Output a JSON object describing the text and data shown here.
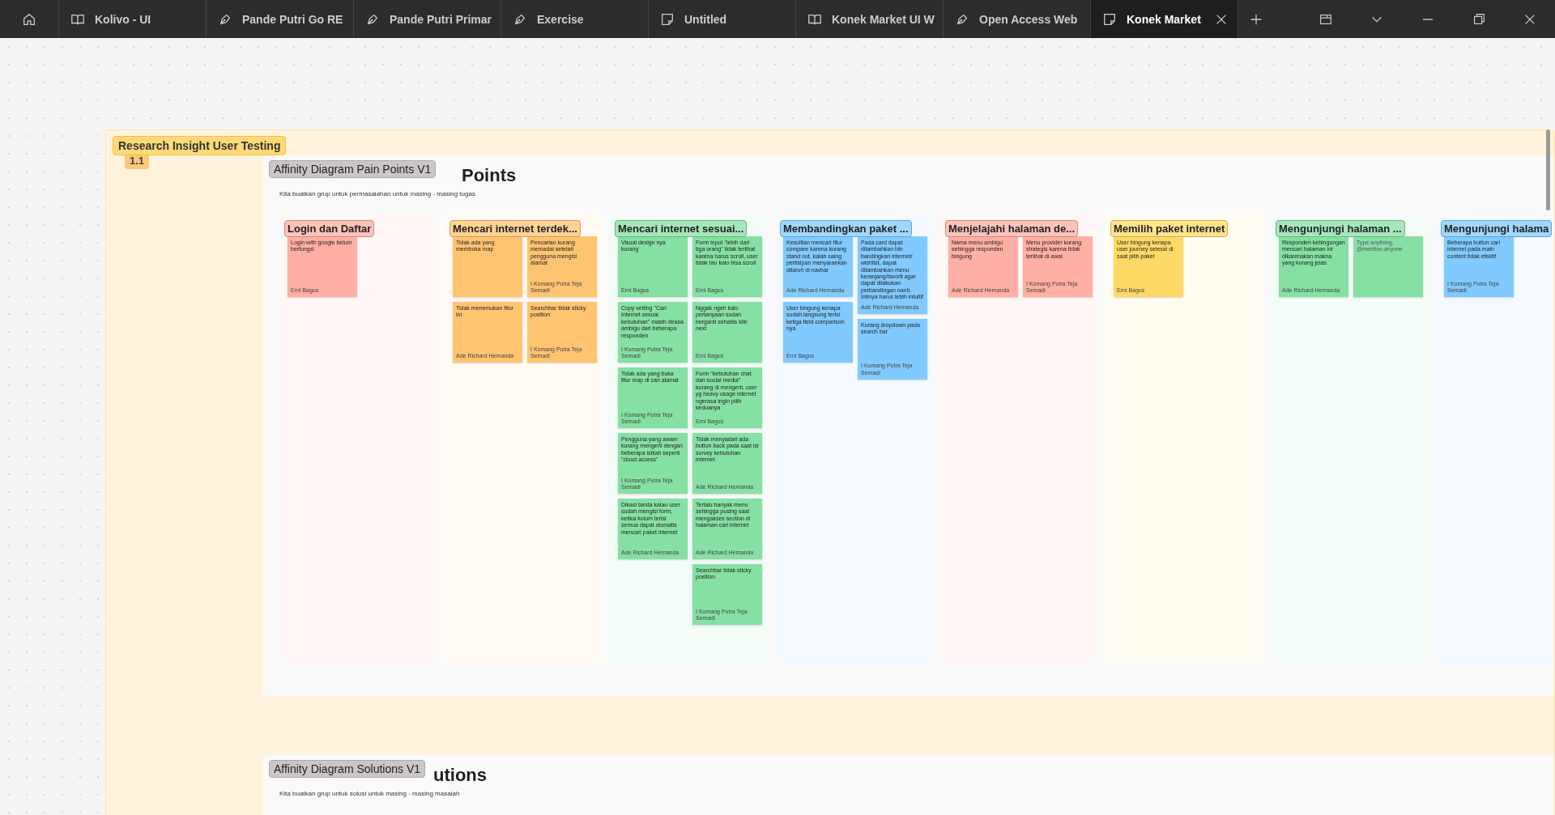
{
  "tabs": [
    {
      "kind": "book",
      "label": "Kolivo - UI",
      "selected": false
    },
    {
      "kind": "pen",
      "label": "Pande Putri Go RE",
      "selected": false
    },
    {
      "kind": "pen",
      "label": "Pande Putri Primar",
      "selected": false
    },
    {
      "kind": "pen",
      "label": "Exercise",
      "selected": false
    },
    {
      "kind": "note",
      "label": "Untitled",
      "selected": false
    },
    {
      "kind": "book",
      "label": "Konek Market UI W",
      "selected": false
    },
    {
      "kind": "pen",
      "label": "Open Access Web",
      "selected": false
    },
    {
      "kind": "note",
      "label": "Konek Market",
      "selected": true
    }
  ],
  "section": {
    "label": "Research Insight User Testing",
    "badge": "1.1"
  },
  "frames": [
    {
      "label": "Affinity Diagram Pain Points V1",
      "heading": "Points",
      "subtitle": "Kita buatkan grup untuk permasalahan untuk masing - masing tugas",
      "columns": [
        {
          "title": "Login dan Daftar",
          "color": "#ffafa3",
          "stacks": [
            [
              {
                "text": "Login with google belum berfungsi",
                "author": "Erni Bagus"
              }
            ]
          ]
        },
        {
          "title": "Mencari internet terdek...",
          "color": "#ffc470",
          "stacks": [
            [
              {
                "text": "Tidak ada yang membuka map"
              },
              {
                "text": "Tidak menemukan fitur ini",
                "author": "Ade Richard Hernanda"
              }
            ],
            [
              {
                "text": "Pencarian kurang memadai setelah pengguna mengisi alamat",
                "author": "I Komang Putra Teja Semadi"
              },
              {
                "text": "Searchbar tidak sticky position",
                "author": "I Komang Putra Teja Semadi"
              }
            ]
          ]
        },
        {
          "title": "Mencari internet sesuai...",
          "color": "#85e0a3",
          "stacks": [
            [
              {
                "text": "Visual design nya kurang",
                "author": "Erni Bagus"
              },
              {
                "text": "Copy writing \"Cari Internet sesuai kebutuhan\" masih dirasa ambigu dari beberapa responden",
                "author": "I Komang Putra Teja Semadi"
              },
              {
                "text": "Tidak ada yang buka fitur map di cari alamat",
                "author": "I Komang Putra Teja Semadi"
              },
              {
                "text": "Pengguna yang awam kurang mengerti dengan beberapa istilah seperti \"cloud access\"",
                "author": "I Komang Putra Teja Semadi"
              },
              {
                "text": "Dikasi tanda kalau user sudah mengisi form, ketika kolom terisi semua dapat otomatis mencari paket internet",
                "author": "Ade Richard Hernanda"
              }
            ],
            [
              {
                "text": "Form input \"lebih dari tiga orang\" tidak terlihat karena harus scroll, user tidak tau kalo bisa scroll",
                "author": "Erni Bagus"
              },
              {
                "text": "Nggak ngeh kalo pertanyaan sudah berganti sehabis klik next",
                "author": "Erni Bagus"
              },
              {
                "text": "Form \"kebutuhan chat dan social media\" kurang di mengerti, user yg heavy usage internet ngerasa ingin pilih keduanya",
                "author": "Erni Bagus"
              },
              {
                "text": "Tidak menyadari ada button back pada saat isi survey kebutuhan internet",
                "author": "Ade Richard Hernanda"
              },
              {
                "text": "Terlalu banyak menu sehingga pusing saat mengakses section di halaman cari internet",
                "author": "Ade Richard Hernanda"
              },
              {
                "text": "Searchbar tidak sticky position",
                "author": "I Komang Putra Teja Semadi"
              }
            ]
          ]
        },
        {
          "title": "Membandingkan paket ...",
          "color": "#80caff",
          "stacks": [
            [
              {
                "text": "Kesulitan mencari fitur compare karena kurang stand out, kalah saing pertisipan menyarankan ditaruh di navbar",
                "author": "Ade Richard Hernanda"
              },
              {
                "text": "User bingung kenapa sudah langsung terisi ketiga field comparison nya",
                "author": "Erni Bagus"
              }
            ],
            [
              {
                "text": "Pada card dapat ditambahkan btn bandingkan internet/ wishlist, dapat ditambahkan menu keranjang/favorit agar dapat dilakukan perbandingan nanti. Intinya harus lebih intuitif",
                "author": "Ade Richard Hernanda"
              },
              {
                "text": "Kurang dropdown pada search bar",
                "author": "I Komang Putra Teja Semadi"
              }
            ]
          ]
        },
        {
          "title": "Menjelajahi halaman de...",
          "color": "#ffafa3",
          "stacks": [
            [
              {
                "text": "Nama menu ambigu sehingga responden bingung",
                "author": "Ade Richard Hernanda"
              }
            ],
            [
              {
                "text": "Menu provider kurang strategis karena tidak terlihat di awal",
                "author": "I Komang Putra Teja Semadi"
              }
            ]
          ]
        },
        {
          "title": "Memilih paket internet",
          "color": "#ffd966",
          "stacks": [
            [
              {
                "text": "User bingung kenapa user journey selesai di saat pilih paket",
                "author": "Erni Bagus"
              }
            ]
          ]
        },
        {
          "title": "Mengunjungi halaman ...",
          "color": "#85e0a3",
          "stacks": [
            [
              {
                "text": "Responden kebingungan mencari halaman ini dikarenakan makna yang kurang jelas",
                "author": "Ade Richard Hernanda"
              }
            ],
            [
              {
                "placeholder": "Type anything, @mention anyone"
              }
            ]
          ]
        },
        {
          "title": "Mengunjungi halama",
          "color": "#80caff",
          "stacks": [
            [
              {
                "text": "Beberapa button cari internet pada main content tidak efektif",
                "author": "I Komang Putra Teja Semadi"
              }
            ]
          ]
        }
      ]
    },
    {
      "label": "Affinity Diagram Solutions V1",
      "heading": "utions",
      "subtitle": "Kita buatkan grup untuk solusi untuk masing - masing masalah"
    }
  ]
}
